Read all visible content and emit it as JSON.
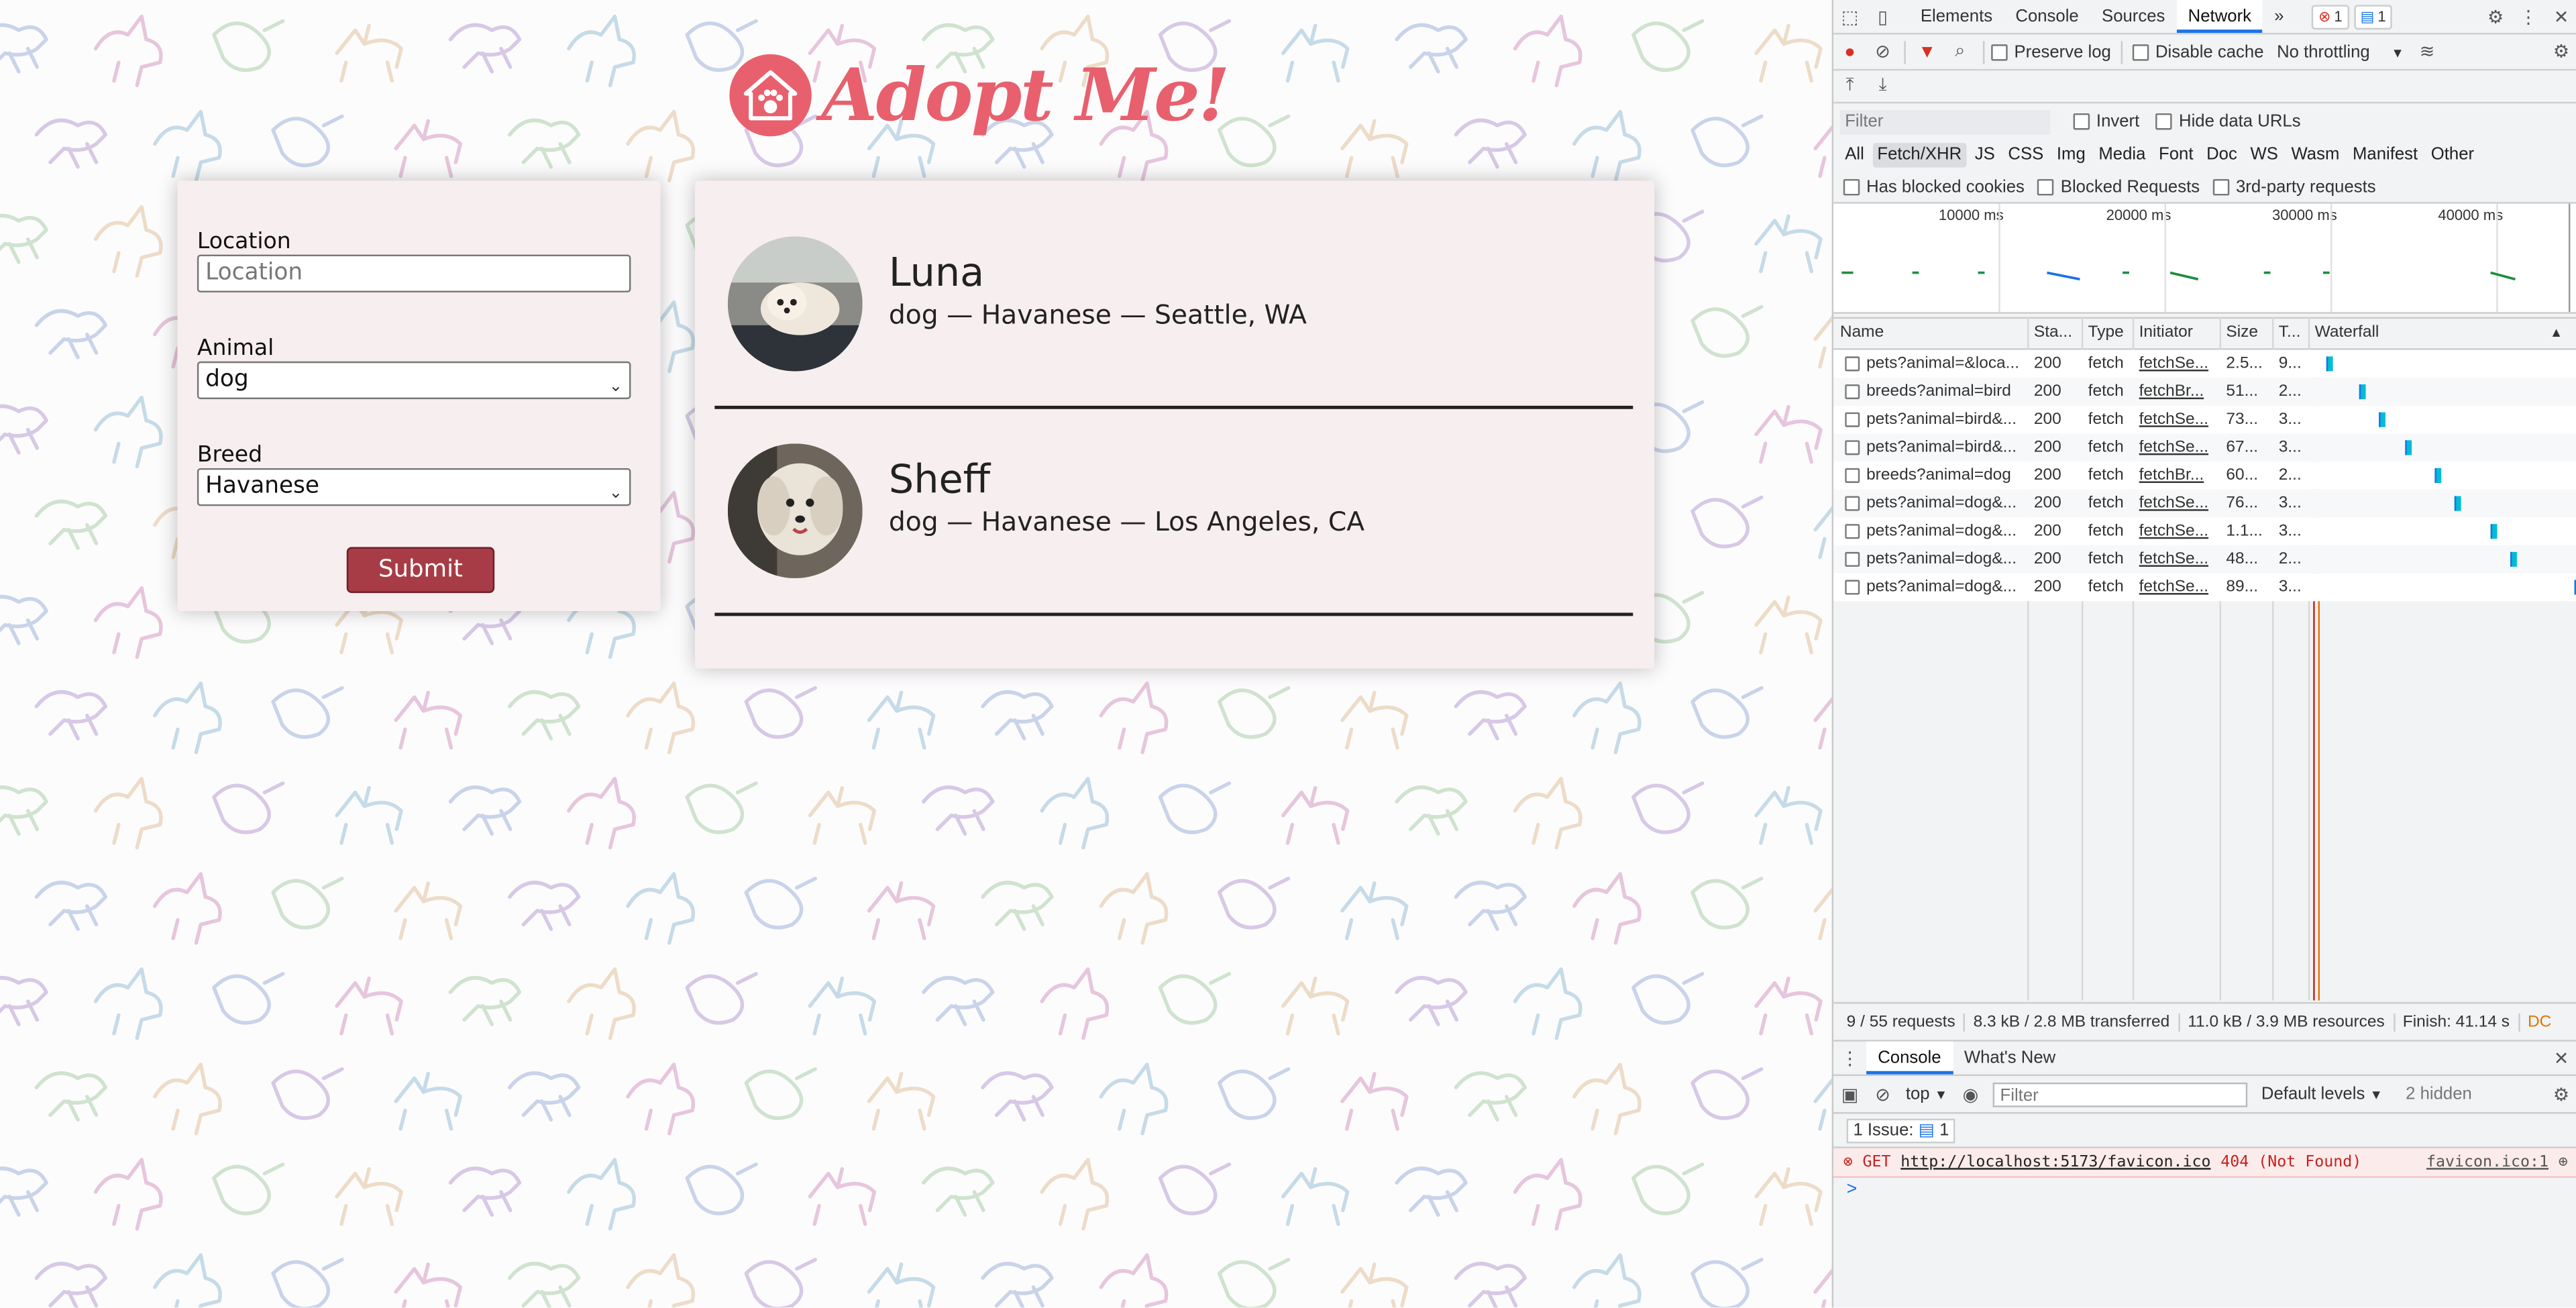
{
  "app": {
    "logo_text": "Adopt Me!",
    "form": {
      "location_label": "Location",
      "location_placeholder": "Location",
      "animal_label": "Animal",
      "animal_value": "dog",
      "breed_label": "Breed",
      "breed_value": "Havanese",
      "submit_label": "Submit"
    },
    "pets": [
      {
        "name": "Luna",
        "description": "dog — Havanese — Seattle, WA"
      },
      {
        "name": "Sheff",
        "description": "dog — Havanese — Los Angeles, CA"
      }
    ]
  },
  "devtools": {
    "tabs": [
      "Elements",
      "Console",
      "Sources",
      "Network"
    ],
    "active_tab": "Network",
    "more_tabs": "»",
    "error_count": "1",
    "message_count": "1",
    "toolbar": {
      "preserve_log": "Preserve log",
      "disable_cache": "Disable cache",
      "throttling": "No throttling"
    },
    "filter": {
      "placeholder": "Filter",
      "invert": "Invert",
      "hide_data_urls": "Hide data URLs"
    },
    "type_filters": [
      "All",
      "Fetch/XHR",
      "JS",
      "CSS",
      "Img",
      "Media",
      "Font",
      "Doc",
      "WS",
      "Wasm",
      "Manifest",
      "Other"
    ],
    "active_type": "Fetch/XHR",
    "checkbox_filters": [
      "Has blocked cookies",
      "Blocked Requests",
      "3rd-party requests"
    ],
    "overview_ticks": [
      "10000 ms",
      "20000 ms",
      "30000 ms",
      "40000 ms"
    ],
    "columns": [
      "Name",
      "Sta...",
      "Type",
      "Initiator",
      "Size",
      "T...",
      "Waterfall"
    ],
    "rows": [
      {
        "name": "pets?animal=&loca...",
        "status": "200",
        "type": "fetch",
        "initiator": "fetchSe...",
        "size": "2.5...",
        "time": "9..."
      },
      {
        "name": "breeds?animal=bird",
        "status": "200",
        "type": "fetch",
        "initiator": "fetchBr...",
        "size": "51...",
        "time": "2..."
      },
      {
        "name": "pets?animal=bird&...",
        "status": "200",
        "type": "fetch",
        "initiator": "fetchSe...",
        "size": "73...",
        "time": "3..."
      },
      {
        "name": "pets?animal=bird&...",
        "status": "200",
        "type": "fetch",
        "initiator": "fetchSe...",
        "size": "67...",
        "time": "3..."
      },
      {
        "name": "breeds?animal=dog",
        "status": "200",
        "type": "fetch",
        "initiator": "fetchBr...",
        "size": "60...",
        "time": "2..."
      },
      {
        "name": "pets?animal=dog&...",
        "status": "200",
        "type": "fetch",
        "initiator": "fetchSe...",
        "size": "76...",
        "time": "3..."
      },
      {
        "name": "pets?animal=dog&...",
        "status": "200",
        "type": "fetch",
        "initiator": "fetchSe...",
        "size": "1.1...",
        "time": "3..."
      },
      {
        "name": "pets?animal=dog&...",
        "status": "200",
        "type": "fetch",
        "initiator": "fetchSe...",
        "size": "48...",
        "time": "2..."
      },
      {
        "name": "pets?animal=dog&...",
        "status": "200",
        "type": "fetch",
        "initiator": "fetchSe...",
        "size": "89...",
        "time": "3..."
      }
    ],
    "summary": {
      "requests": "9 / 55 requests",
      "transferred": "8.3 kB / 2.8 MB transferred",
      "resources": "11.0 kB / 3.9 MB resources",
      "finish": "Finish: 41.14 s",
      "overflow": "DC"
    },
    "console": {
      "tabs": [
        "Console",
        "What's New"
      ],
      "context": "top",
      "filter_placeholder": "Filter",
      "levels": "Default levels",
      "hidden": "2 hidden",
      "issues_label": "1 Issue:",
      "issues_count": "1",
      "error_method": "GET",
      "error_url": "http://localhost:5173/favicon.ico",
      "error_status": "404 (Not Found)",
      "error_source": "favicon.ico:1",
      "prompt": ">"
    }
  }
}
